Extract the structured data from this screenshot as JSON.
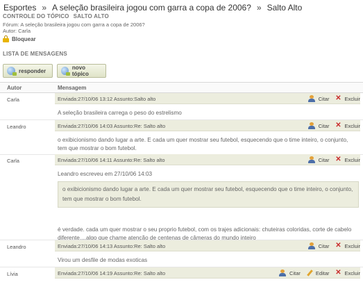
{
  "breadcrumb": {
    "items": [
      "Esportes",
      "A seleção brasileira jogou com garra a copa de 2006?",
      "Salto Alto"
    ],
    "separator": "»"
  },
  "topic": {
    "control_title": "CONTROLE DO TÓPICO",
    "topic_name": "SALTO ALTO",
    "forum_line": "Fórum: A seleção brasileira jogou com garra a copa de 2006?",
    "author_line": "Autor:  Carla",
    "lock_label": "Bloquear"
  },
  "list": {
    "title": "LISTA DE MENSAGENS",
    "reply_button": "responder",
    "new_topic_button": "novo tópico",
    "col_author": "Autor",
    "col_message": "Mensagem"
  },
  "actions": {
    "cite": "Citar",
    "edit": "Editar",
    "delete": "Excluir"
  },
  "posts": [
    {
      "author": "Carla",
      "meta": "Enviada:27/10/06 13:12   Assunto:Salto alto",
      "body": "A seleção brasileira carrega o peso do estrelismo"
    },
    {
      "author": "Leandro",
      "meta": "Enviada:27/10/06 14:03   Assunto:Re: Salto alto",
      "body": "o exibicionismo dando lugar a arte. E cada um quer mostrar seu futebol, esquecendo que o time inteiro, o conjunto, tem que mostrar o bom futebol."
    },
    {
      "author": "Carla",
      "meta": "Enviada:27/10/06 14:11   Assunto:Re: Salto alto",
      "quote_head": "Leandro escreveu em 27/10/06 14:03",
      "quote": "o exibicionismo dando lugar a arte. E cada um quer mostrar seu futebol, esquecendo que o time inteiro, o conjunto, tem que mostrar o bom futebol.",
      "body": "é verdade. cada um quer mostrar o seu proprio futebol, com os trajes adicionais: chuteiras coloridas, corte de cabelo diferente....algo que chame atenção de centenas de câmeras do mundo inteiro"
    },
    {
      "author": "Leandro",
      "meta": "Enviada:27/10/06 14:13   Assunto:Re: Salto alto",
      "body": "Virou um desfile de modas exoticas"
    },
    {
      "author": "Lívia",
      "meta": "Enviada:27/10/06 14:19   Assunto:Re: Salto alto",
      "body": ""
    }
  ]
}
